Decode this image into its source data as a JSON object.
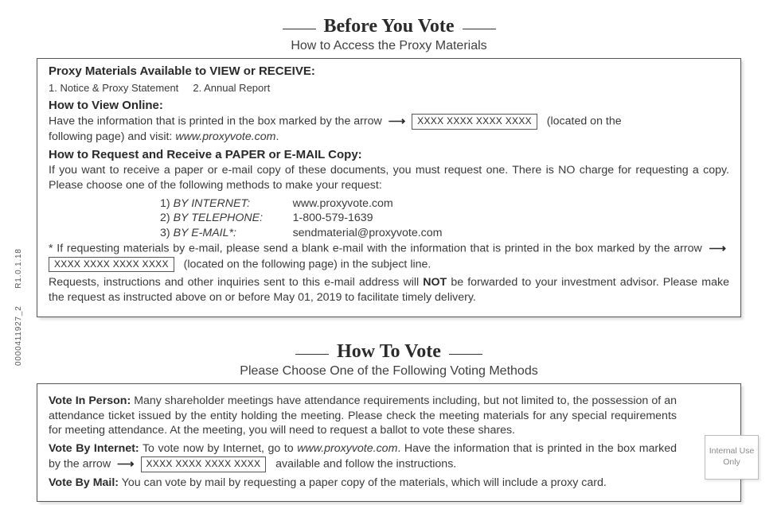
{
  "section1": {
    "title": "Before You Vote",
    "subtitle": "How to Access the Proxy Materials",
    "h_available": "Proxy Materials Available to VIEW or RECEIVE:",
    "list_items": "1. Notice & Proxy Statement     2. Annual Report",
    "h_view": "How to View Online:",
    "view_pre": "Have the information that is printed in the box marked by the arrow",
    "code": "XXXX XXXX XXXX XXXX",
    "view_post1": "(located on the",
    "view_post2": "following page) and visit:",
    "view_url": "www.proxyvote.com",
    "h_request": "How to Request and Receive a PAPER or E-MAIL Copy:",
    "req_p1": "If you want to receive a paper or e-mail copy of these documents, you must request one.  There is NO charge for requesting a copy.  Please choose one of the following methods to make your request:",
    "m1_num": "1)",
    "m1_lab": "BY INTERNET:",
    "m1_val": "www.proxyvote.com",
    "m2_num": "2)",
    "m2_lab": "BY TELEPHONE:",
    "m2_val": "1-800-579-1639",
    "m3_num": "3)",
    "m3_lab": "BY E-MAIL*:",
    "m3_val": "sendmaterial@proxyvote.com",
    "star_pre": "*   If requesting materials by e-mail, please send a blank e-mail with the information that is printed in the box marked by the arrow",
    "star_post": "(located on the following page) in the subject line.",
    "req_p2a": "Requests, instructions and other inquiries sent to this e-mail address will ",
    "req_p2b": "NOT",
    "req_p2c": " be forwarded to your investment advisor. Please make the request as instructed above on or before ",
    "req_date": "May 01, 2019",
    "req_p2d": " to facilitate timely delivery."
  },
  "section2": {
    "title": "How To Vote",
    "subtitle": "Please Choose One of the Following Voting Methods",
    "p1_h": "Vote In Person:",
    "p1": " Many shareholder meetings have attendance requirements including, but not limited to, the possession of an attendance ticket issued by the entity holding the meeting. Please check the meeting materials for any special requirements for meeting attendance.  At the meeting, you will need to request a ballot to vote these shares.",
    "p2_h": "Vote By Internet:",
    "p2_a": " To vote now by Internet, go to ",
    "p2_url": "www.proxyvote.com",
    "p2_b": ".  Have the information that is printed in the box marked by the arrow",
    "p2_c": "available and follow the instructions.",
    "p3_h": "Vote By Mail:",
    "p3": " You can vote by mail by requesting a paper copy of the materials, which will include a proxy card."
  },
  "side": {
    "code": "0000411927_2",
    "rev": "R1.0.1.18"
  },
  "internal": {
    "l1": "Internal Use",
    "l2": "Only"
  }
}
